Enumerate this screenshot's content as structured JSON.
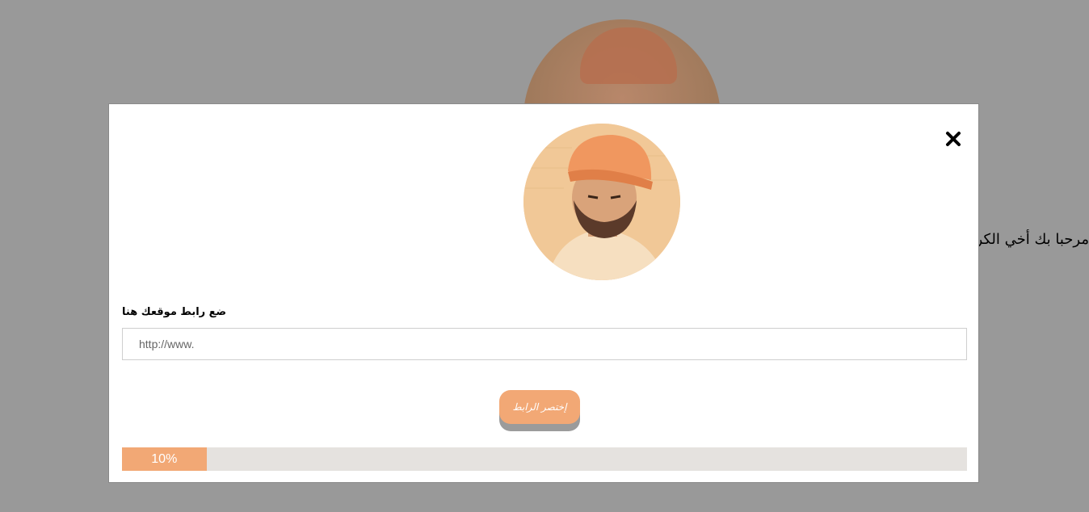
{
  "background": {
    "greeting": "مرحبا بك أخي الكريم"
  },
  "modal": {
    "url_label": "ضع رابط موقعك هنا",
    "url_input": {
      "placeholder": "http://www.",
      "value": ""
    },
    "shorten_button_label": "إختصر الرابط",
    "progress": {
      "percent": 10,
      "label": "10%"
    }
  },
  "colors": {
    "overlay": "#999999",
    "accent": "#f2a875",
    "progress_track": "#e5e2df",
    "button_shadow": "#9b9b9b"
  },
  "icons": {
    "close": "close-icon"
  }
}
